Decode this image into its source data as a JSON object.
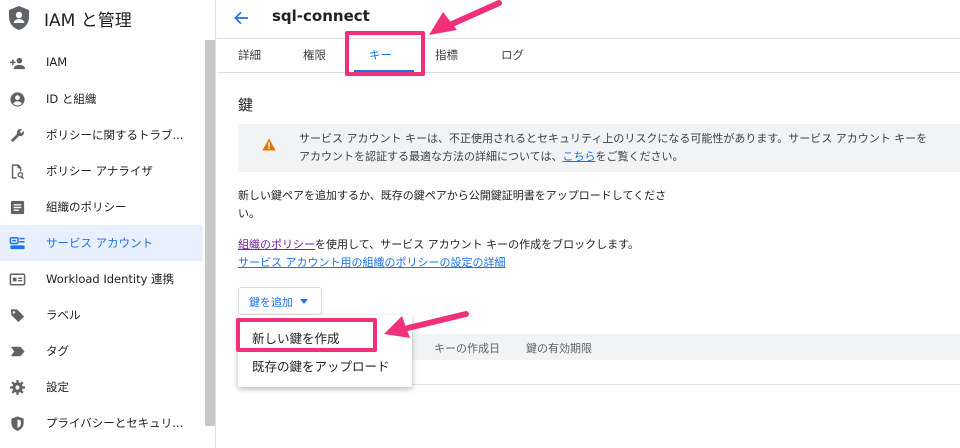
{
  "sidebar": {
    "title": "IAM と管理",
    "items": [
      {
        "label": "IAM",
        "icon": "person-add-icon",
        "active": false
      },
      {
        "label": "ID と組織",
        "icon": "account-circle-icon",
        "active": false
      },
      {
        "label": "ポリシーに関するトラブ...",
        "icon": "wrench-icon",
        "active": false
      },
      {
        "label": "ポリシー アナライザ",
        "icon": "document-search-icon",
        "active": false
      },
      {
        "label": "組織のポリシー",
        "icon": "list-box-icon",
        "active": false
      },
      {
        "label": "サービス アカウント",
        "icon": "service-account-icon",
        "active": true
      },
      {
        "label": "Workload Identity 連携",
        "icon": "id-card-icon",
        "active": false
      },
      {
        "label": "ラベル",
        "icon": "tag-icon",
        "active": false
      },
      {
        "label": "タグ",
        "icon": "label-arrow-icon",
        "active": false
      },
      {
        "label": "設定",
        "icon": "gear-icon",
        "active": false
      },
      {
        "label": "プライバシーとセキュリ...",
        "icon": "shield-icon",
        "active": false
      }
    ]
  },
  "header": {
    "title": "sql-connect",
    "tabs": [
      {
        "label": "詳細"
      },
      {
        "label": "権限"
      },
      {
        "label": "キー"
      },
      {
        "label": "指標"
      },
      {
        "label": "ログ"
      }
    ],
    "active_tab": "キー"
  },
  "main": {
    "section_title": "鍵",
    "alert": {
      "line1": "サービス アカウント キーは、不正使用されるとセキュリティ上のリスクになる可能性があります。サービス アカウント キーを",
      "line2_prefix": "アカウントを認証する最適な方法の詳細については、",
      "line2_link": "こちら",
      "line2_suffix": "をご覧ください。"
    },
    "intro_line1": "新しい鍵ペアを追加するか、既存の鍵ペアから公開鍵証明書をアップロードしてくださ",
    "intro_line2": "い。",
    "policy_link": "組織のポリシー",
    "policy_text": "を使用して、サービス アカウント キーの作成をブロックします。",
    "policy_detail_link": "サービス アカウント用の組織のポリシーの設定の詳細",
    "add_key_label": "鍵を追加",
    "table_columns": [
      "キーの作成日",
      "鍵の有効期限"
    ],
    "menu_items": [
      "新しい鍵を作成",
      "既存の鍵をアップロード"
    ]
  },
  "colors": {
    "accent": "#1a73e8",
    "highlight": "#f0307a",
    "warning": "#e37400",
    "active_bg": "#e8f0fe"
  }
}
